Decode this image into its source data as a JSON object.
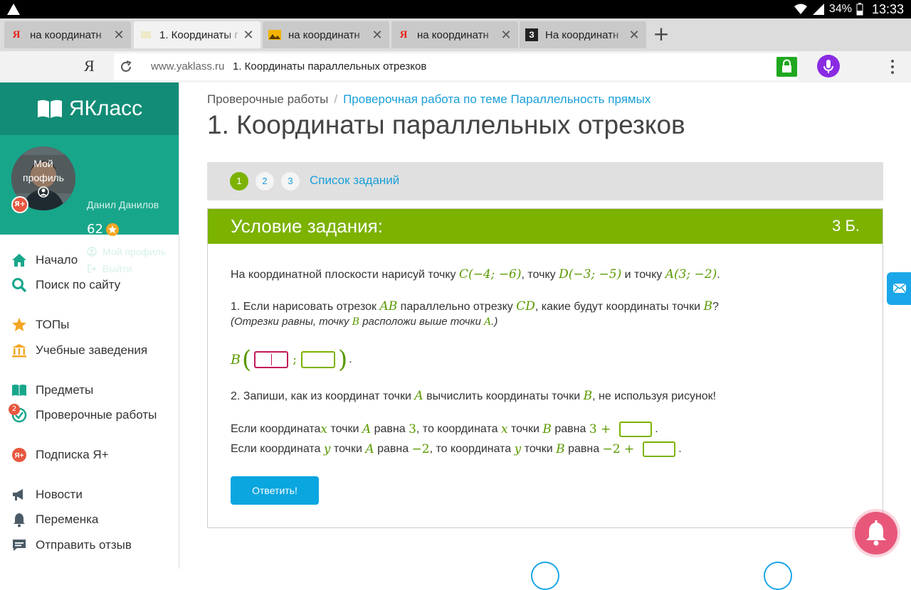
{
  "status": {
    "battery": "34%",
    "time": "13:33"
  },
  "browser": {
    "tabs": [
      {
        "title": "на координатн",
        "favicon": "yandex-icon",
        "active": false
      },
      {
        "title": "1. Координаты г",
        "favicon": "page-icon",
        "active": true
      },
      {
        "title": "на координатн",
        "favicon": "image-icon",
        "active": false
      },
      {
        "title": "на координатн",
        "favicon": "yandex-icon",
        "active": false
      },
      {
        "title": "На координатн",
        "favicon": "znanija-icon",
        "active": false
      }
    ],
    "logo": "Я",
    "domain": "www.yaklass.ru",
    "page_title": "1. Координаты параллельных отрезков"
  },
  "sidebar": {
    "logo_text": "ЯКласс",
    "profile": {
      "avatar_label_1": "Мой",
      "avatar_label_2": "профиль",
      "name": "Данил Данилов",
      "score": "62",
      "profile_link": "Мой профиль",
      "logout_link": "Выйти",
      "yplus_badge": "Я+"
    },
    "nav": [
      {
        "label": "Начало",
        "icon": "home-icon"
      },
      {
        "label": "Поиск по сайту",
        "icon": "search-icon"
      },
      {
        "label": "ТОПы",
        "icon": "star-icon"
      },
      {
        "label": "Учебные заведения",
        "icon": "school-icon"
      },
      {
        "label": "Предметы",
        "icon": "books-icon"
      },
      {
        "label": "Проверочные работы",
        "icon": "check-icon"
      },
      {
        "label": "Подписка Я+",
        "icon": "yplus-icon"
      },
      {
        "label": "Новости",
        "icon": "megaphone-icon"
      },
      {
        "label": "Переменка",
        "icon": "bell-icon"
      },
      {
        "label": "Отправить отзыв",
        "icon": "feedback-icon"
      }
    ],
    "tests_badge": "2"
  },
  "breadcrumb": {
    "root": "Проверочные работы",
    "sep": "/",
    "current": "Проверочная работа по теме Параллельность прямых"
  },
  "page_title": "1. Координаты параллельных отрезков",
  "task_nav": {
    "pages": [
      "1",
      "2",
      "3"
    ],
    "active": "1",
    "list_link": "Список заданий"
  },
  "task": {
    "header": "Условие задания:",
    "points": "3 Б.",
    "intro_a": "На координатной плоскости нарисуй точку ",
    "point_c": "C(−4; −6)",
    "intro_b": ", точку ",
    "point_d": "D(−3; −5)",
    "intro_c": " и точку ",
    "point_a": "A(3; −2)",
    "intro_d": ".",
    "q1_a": "1. Если нарисовать отрезок ",
    "q1_ab": "AB",
    "q1_b": " параллельно отрезку ",
    "q1_cd": "CD",
    "q1_c": ", какие будут координаты точки ",
    "q1_bvar": "B",
    "q1_d": "?",
    "hint_a": "(Отрезки равны, точку ",
    "hint_b": "B",
    "hint_c": " расположи выше точки ",
    "hint_d": "A",
    "hint_e": ".)",
    "answer_label": "B",
    "answer_sep": ";",
    "answer_end": ".",
    "q2": "2. Запиши, как из координат точки ",
    "q2_a": "A",
    "q2_b": " вычислить координаты точки ",
    "q2_bv": "B",
    "q2_c": ", не используя рисунок!",
    "line_x": {
      "t1": "Если координата ",
      "var": "x",
      "t2": " точки ",
      "p1": "A",
      "t3": " равна ",
      "val": "3",
      "t4": ", то координата ",
      "var2": "x",
      "t5": " точки ",
      "p2": "B",
      "t6": " равна ",
      "expr": "3 +",
      "end": "."
    },
    "line_y": {
      "t1": "Если координата ",
      "var": "y",
      "t2": " точки ",
      "p1": "A",
      "t3": " равна ",
      "val": "−2",
      "t4": ", то координата ",
      "var2": "y",
      "t5": " точки ",
      "p2": "B",
      "t6": " равна ",
      "expr": "−2 +",
      "end": "."
    },
    "submit": "Ответить!"
  }
}
